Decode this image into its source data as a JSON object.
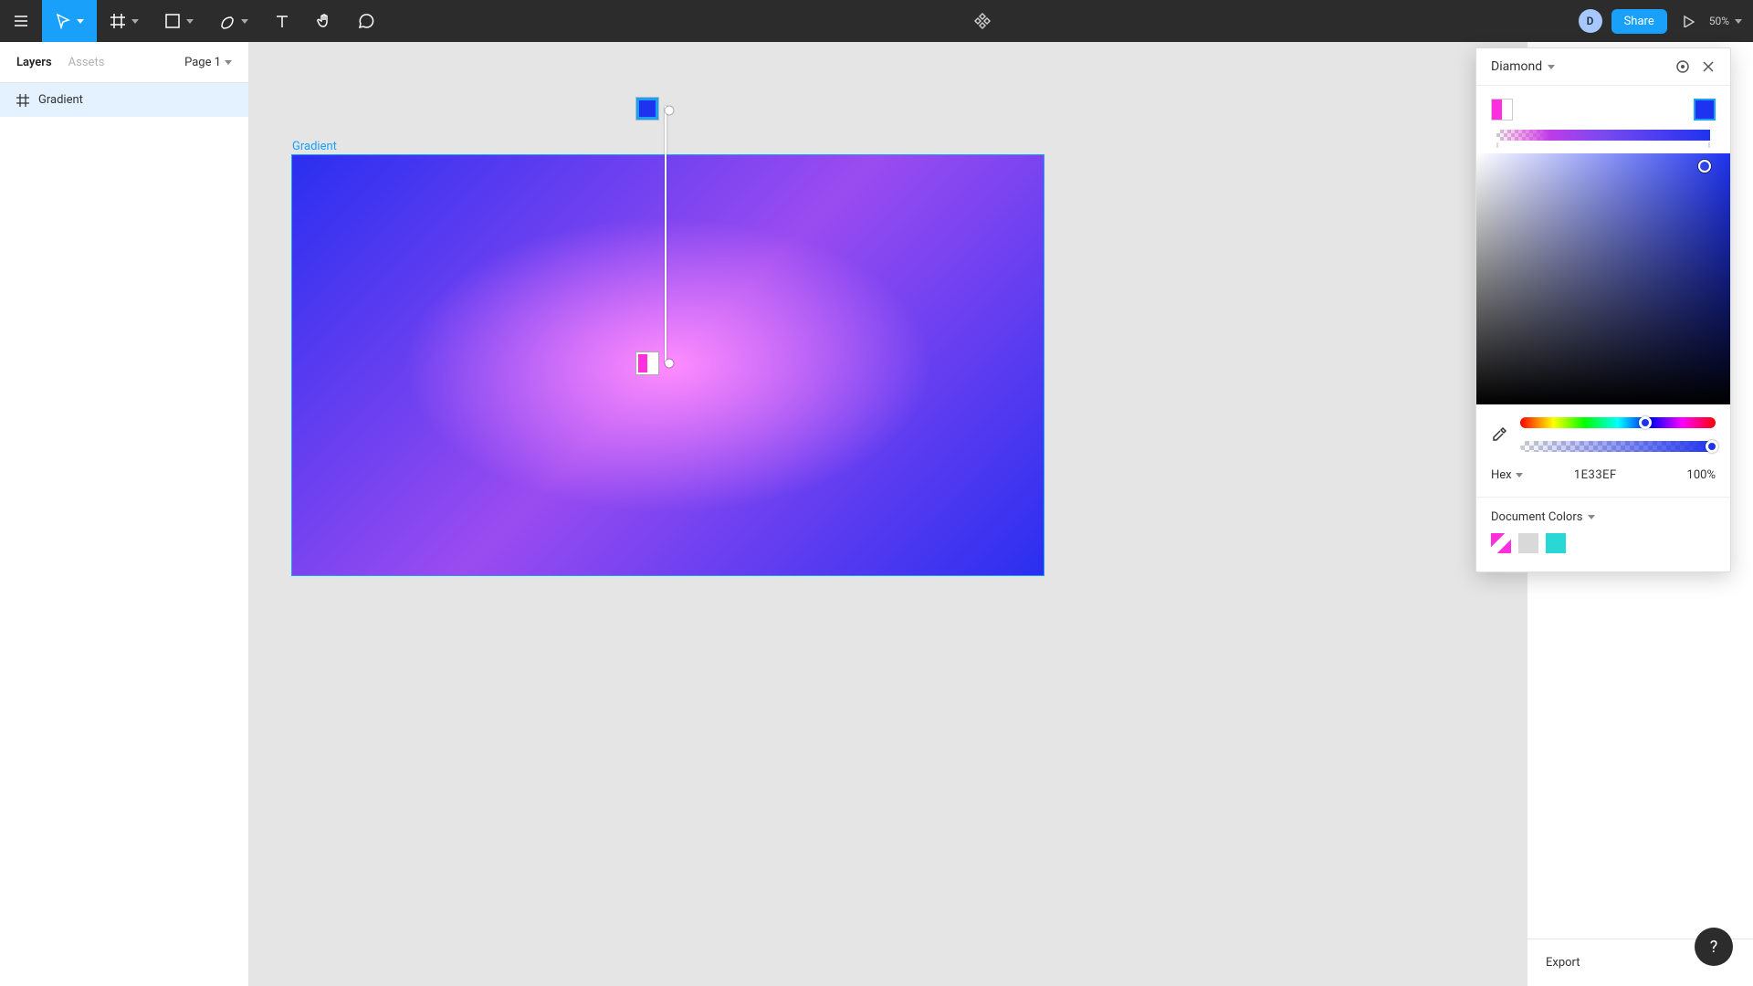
{
  "toolbar": {
    "avatar_initial": "D",
    "share_label": "Share",
    "zoom_label": "50%"
  },
  "left_panel": {
    "tabs": [
      "Layers",
      "Assets"
    ],
    "active_tab": 0,
    "page_selector": "Page 1",
    "layers": [
      {
        "name": "Gradient",
        "type": "frame"
      }
    ]
  },
  "canvas": {
    "frame_label": "Gradient",
    "gradient_stops": [
      {
        "color": "#FF2FE0",
        "position": 0,
        "alpha": 50
      },
      {
        "color": "#1E33EF",
        "position": 100,
        "alpha": 100
      }
    ]
  },
  "picker": {
    "type_label": "Diamond",
    "color_mode": "Hex",
    "hex_value": "1E33EF",
    "opacity": "100%",
    "doc_colors_label": "Document Colors",
    "document_colors": [
      "gradient-pink",
      "#D9D9D9",
      "#29D8D5"
    ]
  },
  "right_rail": {
    "export_label": "Export"
  },
  "help_label": "?"
}
